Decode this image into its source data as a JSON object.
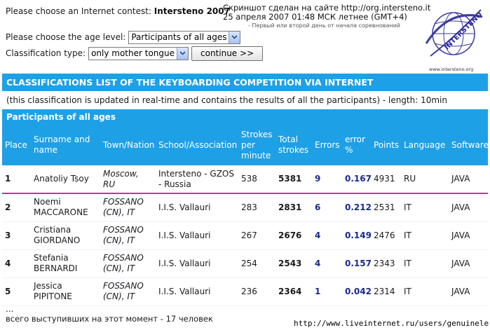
{
  "header": {
    "contest_prompt": "Please choose an Internet contest:",
    "contest_name": "Intersteno 2007",
    "age_prompt": "Please choose the age level:",
    "age_value": "Participants of all ages",
    "class_prompt": "Classification type:",
    "class_value": "only mother tongue",
    "continue_label": "continue >>"
  },
  "screenshot_note": {
    "line1": "Скриншот сделан на сайте http://org.intersteno.it",
    "line2": "25 апреля 2007 01:48 МСК летнее (GMT+4)",
    "line3": "- Первый или второй день от начала соревнований"
  },
  "logo": {
    "text": "INTERSTENO",
    "url": "www.intersteno.org"
  },
  "section_title": "CLASSIFICATIONS LIST OF THE KEYBOARDING COMPETITION VIA INTERNET",
  "info_text": "(this classification is updated in real-time and contains the results of all the participants) - length: 10min",
  "group_title": "Participants of all ages",
  "table": {
    "headers": [
      "Place",
      "Surname and name",
      "Town/Nation",
      "School/Association",
      "Strokes per minute",
      "Total strokes",
      "Errors",
      "error %",
      "Points",
      "Language",
      "Software"
    ],
    "rows": [
      {
        "place": "1",
        "name": "Anatoliy Tsoy",
        "town": "Moscow, RU",
        "school": "Intersteno - GZOS - Russia",
        "spm": "538",
        "total": "5381",
        "errors": "9",
        "err_pct": "0.167",
        "points": "4931",
        "lang": "RU",
        "soft": "JAVA"
      },
      {
        "place": "2",
        "name": "Noemi MACCARONE",
        "town": "FOSSANO (CN), IT",
        "school": "I.I.S. Vallauri",
        "spm": "283",
        "total": "2831",
        "errors": "6",
        "err_pct": "0.212",
        "points": "2531",
        "lang": "IT",
        "soft": "JAVA"
      },
      {
        "place": "3",
        "name": "Cristiana GIORDANO",
        "town": "FOSSANO (CN), IT",
        "school": "I.I.S. Vallauri",
        "spm": "267",
        "total": "2676",
        "errors": "4",
        "err_pct": "0.149",
        "points": "2476",
        "lang": "IT",
        "soft": "JAVA"
      },
      {
        "place": "4",
        "name": "Stefania BERNARDI",
        "town": "FOSSANO (CN), IT",
        "school": "I.I.S. Vallauri",
        "spm": "254",
        "total": "2543",
        "errors": "4",
        "err_pct": "0.157",
        "points": "2343",
        "lang": "IT",
        "soft": "JAVA"
      },
      {
        "place": "5",
        "name": "Jessica PIPITONE",
        "town": "FOSSANO (CN), IT",
        "school": "I.I.S. Vallauri",
        "spm": "236",
        "total": "2364",
        "errors": "1",
        "err_pct": "0.042",
        "points": "2314",
        "lang": "IT",
        "soft": "JAVA"
      }
    ]
  },
  "footer": {
    "dots": "...",
    "total_text": "всего выступивших на этот момент - 17 человек",
    "credit": "http://www.liveinternet.ru/users/genuinelera/"
  },
  "colors": {
    "accent_blue": "#1ea0e6",
    "highlight_line": "#c8348a"
  }
}
